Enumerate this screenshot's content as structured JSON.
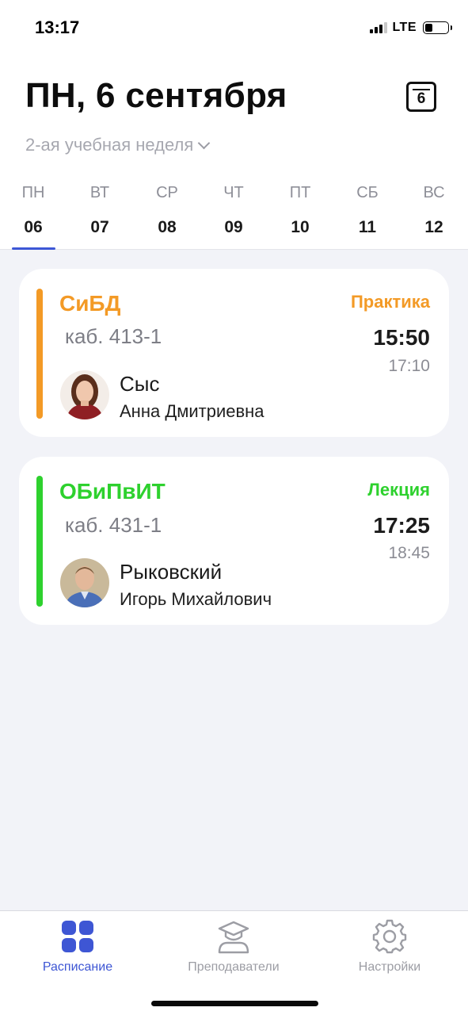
{
  "status_bar": {
    "time": "13:17",
    "network": "LTE",
    "battery_level": 0.25
  },
  "header": {
    "title": "ПН, 6 сентября",
    "calendar_day": "6",
    "week_label": "2-ая учебная неделя"
  },
  "days": [
    {
      "name": "ПН",
      "date": "06",
      "selected": true
    },
    {
      "name": "ВТ",
      "date": "07"
    },
    {
      "name": "СР",
      "date": "08"
    },
    {
      "name": "ЧТ",
      "date": "09"
    },
    {
      "name": "ПТ",
      "date": "10"
    },
    {
      "name": "СБ",
      "date": "11"
    },
    {
      "name": "ВС",
      "date": "12"
    }
  ],
  "lessons": [
    {
      "subject": "СиБД",
      "type": "Практика",
      "room": "каб. 413-1",
      "start": "15:50",
      "end": "17:10",
      "teacher_last": "Сыс",
      "teacher_first": "Анна Дмитриевна",
      "color": "#f39a26"
    },
    {
      "subject": "ОБиПвИТ",
      "type": "Лекция",
      "room": "каб. 431-1",
      "start": "17:25",
      "end": "18:45",
      "teacher_last": "Рыковский",
      "teacher_first": "Игорь Михайлович",
      "color": "#2ed12e"
    }
  ],
  "tabbar": {
    "schedule": "Расписание",
    "teachers": "Преподаватели",
    "settings": "Настройки",
    "active_color": "#3e56d4",
    "inactive_color": "#9c9da4"
  }
}
